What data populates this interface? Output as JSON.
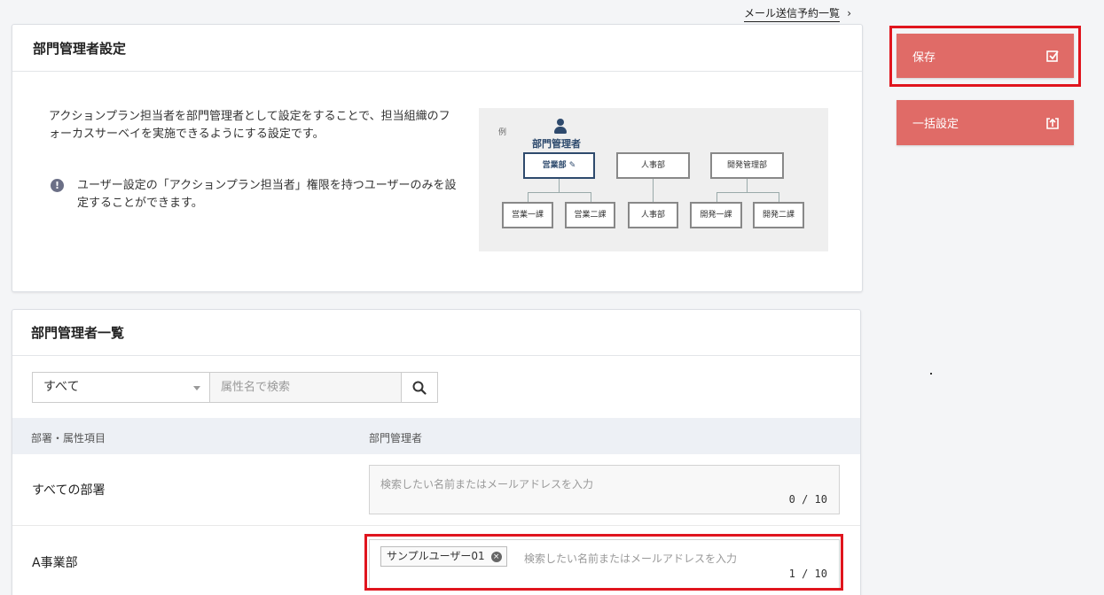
{
  "top_link": {
    "label": "メール送信予約一覧"
  },
  "settings_card": {
    "title": "部門管理者設定",
    "description": "アクションプラン担当者を部門管理者として設定をすることで、担当組織のフォーカスサーベイを実施できるようにする設定です。",
    "note": "ユーザー設定の「アクションプラン担当者」権限を持つユーザーのみを設定することができます。",
    "diagram": {
      "example_label": "例",
      "manager_label": "部門管理者",
      "top_units": [
        "営業部",
        "人事部",
        "開発管理部"
      ],
      "sub_units": [
        "営業一課",
        "営業二課",
        "人事部",
        "開発一課",
        "開発二課"
      ]
    }
  },
  "list_card": {
    "title": "部門管理者一覧",
    "filter": {
      "selected": "すべて",
      "search_placeholder": "属性名で検索"
    },
    "columns": [
      "部署・属性項目",
      "部門管理者"
    ],
    "rows": [
      {
        "label": "すべての部署",
        "placeholder": "検索したい名前またはメールアドレスを入力",
        "count": "0 / 10",
        "tags": []
      },
      {
        "label": "A事業部",
        "placeholder": "検索したい名前またはメールアドレスを入力",
        "count": "1 / 10",
        "tags": [
          "サンプルユーザー01"
        ]
      }
    ]
  },
  "actions": {
    "save_label": "保存",
    "bulk_label": "一括設定"
  },
  "colors": {
    "button": "#e06b67",
    "highlight": "#e0151e",
    "diagram_accent": "#2e4a6d"
  }
}
